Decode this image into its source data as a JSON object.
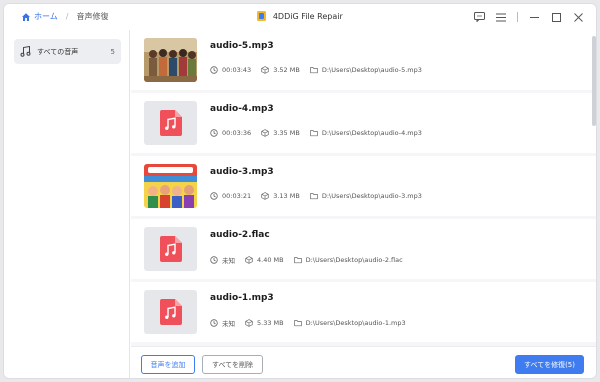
{
  "breadcrumb": {
    "home": "ホーム",
    "current": "音声修復"
  },
  "app": {
    "title": "4DDiG File Repair"
  },
  "sidebar": {
    "items": [
      {
        "label": "すべての音声",
        "count": "5"
      }
    ]
  },
  "files": [
    {
      "name": "audio-5.mp3",
      "duration": "00:03:43",
      "size": "3.52 MB",
      "path": "D:\\Users\\Desktop\\audio-5.mp3",
      "thumb": "photo"
    },
    {
      "name": "audio-4.mp3",
      "duration": "00:03:36",
      "size": "3.35 MB",
      "path": "D:\\Users\\Desktop\\audio-4.mp3",
      "thumb": "music-file-icon"
    },
    {
      "name": "audio-3.mp3",
      "duration": "00:03:21",
      "size": "3.13 MB",
      "path": "D:\\Users\\Desktop\\audio-3.mp3",
      "thumb": "cover-art"
    },
    {
      "name": "audio-2.flac",
      "duration": "未知",
      "size": "4.40 MB",
      "path": "D:\\Users\\Desktop\\audio-2.flac",
      "thumb": "music-file-icon"
    },
    {
      "name": "audio-1.mp3",
      "duration": "未知",
      "size": "5.33 MB",
      "path": "D:\\Users\\Desktop\\audio-1.mp3",
      "thumb": "music-file-icon"
    }
  ],
  "footer": {
    "add_label": "音声を追加",
    "delete_label": "すべてを削除",
    "repair_label": "すべてを修復(5)"
  },
  "colors": {
    "accent": "#3f7cf0",
    "file_icon": "#f0505a"
  }
}
